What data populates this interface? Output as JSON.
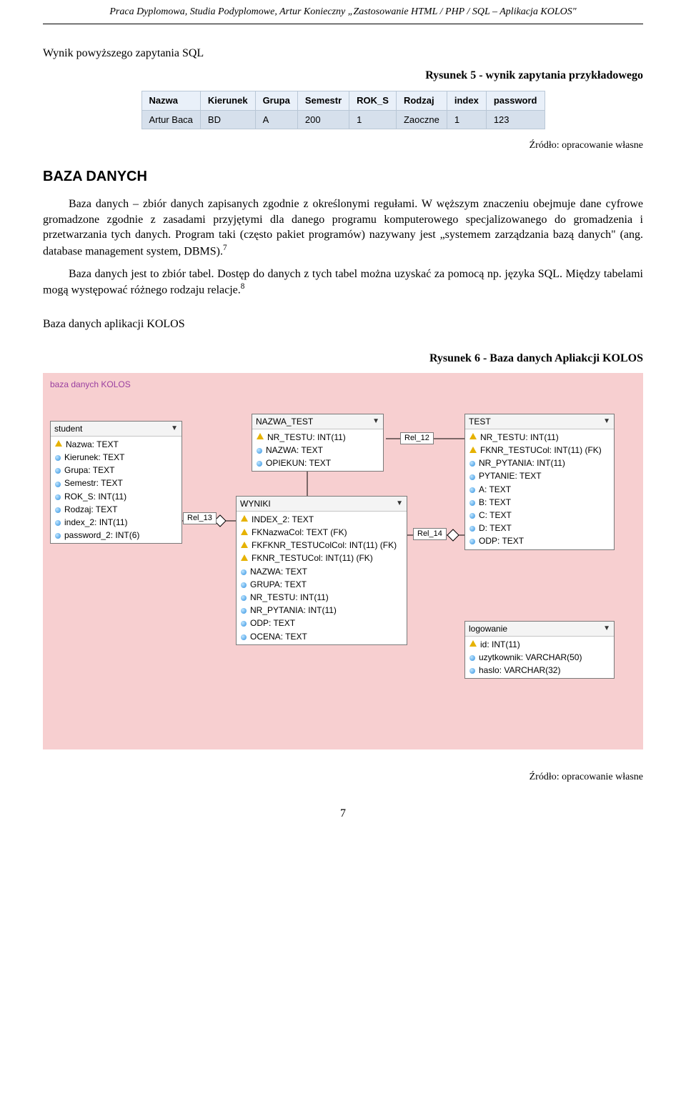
{
  "header": "Praca Dyplomowa, Studia Podyplomowe, Artur Konieczny „Zastosowanie HTML / PHP / SQL – Aplikacja KOLOS\"",
  "para_title": "Wynik powyższego zapytania SQL",
  "figure5_caption": "Rysunek 5 - wynik zapytania przykładowego",
  "source": "Źródło: opracowanie własne",
  "section_title": "BAZA DANYCH",
  "body": {
    "p1a": "Baza danych – zbiór danych zapisanych zgodnie z określonymi regułami. W węższym znaczeniu obejmuje dane cyfrowe gromadzone zgodnie z zasadami przyjętymi dla danego programu komputerowego specjalizowanego do gromadzenia i przetwarzania tych danych. Program taki (często pakiet programów) nazywany jest „systemem zarządzania bazą danych\" (ang. database management system, DBMS).",
    "p1_sup": "7",
    "p2a": "Baza danych jest to zbiór tabel. Dostęp do danych z tych tabel można uzyskać za pomocą np. języka SQL. Między tabelami mogą występować różnego rodzaju relacje.",
    "p2_sup": "8",
    "sub_heading": "Baza danych aplikacji  KOLOS"
  },
  "figure6_caption": "Rysunek 6 - Baza danych Apliakcji KOLOS",
  "page_number": "7",
  "sql_table": {
    "headers": [
      "Nazwa",
      "Kierunek",
      "Grupa",
      "Semestr",
      "ROK_S",
      "Rodzaj",
      "index",
      "password"
    ],
    "rows": [
      [
        "Artur Baca",
        "BD",
        "A",
        "200",
        "1",
        "Zaoczne",
        "1",
        "123"
      ]
    ]
  },
  "schema": {
    "panel_title": "baza danych KOLOS",
    "tables": {
      "student": {
        "name": "student",
        "cols": [
          {
            "k": true,
            "t": "Nazwa: TEXT"
          },
          {
            "k": false,
            "t": "Kierunek: TEXT"
          },
          {
            "k": false,
            "t": "Grupa: TEXT"
          },
          {
            "k": false,
            "t": "Semestr: TEXT"
          },
          {
            "k": false,
            "t": "ROK_S: INT(11)"
          },
          {
            "k": false,
            "t": "Rodzaj: TEXT"
          },
          {
            "k": false,
            "t": "index_2: INT(11)"
          },
          {
            "k": false,
            "t": "password_2: INT(6)"
          }
        ]
      },
      "nazwa_test": {
        "name": "NAZWA_TEST",
        "cols": [
          {
            "k": true,
            "t": "NR_TESTU: INT(11)"
          },
          {
            "k": false,
            "t": "NAZWA: TEXT"
          },
          {
            "k": false,
            "t": "OPIEKUN: TEXT"
          }
        ]
      },
      "wyniki": {
        "name": "WYNIKI",
        "cols": [
          {
            "k": true,
            "t": "INDEX_2: TEXT"
          },
          {
            "k": true,
            "t": "FKNazwaCol: TEXT (FK)"
          },
          {
            "k": true,
            "t": "FKFKNR_TESTUColCol: INT(11) (FK)"
          },
          {
            "k": true,
            "t": "FKNR_TESTUCol: INT(11) (FK)"
          },
          {
            "k": false,
            "t": "NAZWA: TEXT"
          },
          {
            "k": false,
            "t": "GRUPA: TEXT"
          },
          {
            "k": false,
            "t": "NR_TESTU: INT(11)"
          },
          {
            "k": false,
            "t": "NR_PYTANIA: INT(11)"
          },
          {
            "k": false,
            "t": "ODP: TEXT"
          },
          {
            "k": false,
            "t": "OCENA: TEXT"
          }
        ]
      },
      "test": {
        "name": "TEST",
        "cols": [
          {
            "k": true,
            "t": "NR_TESTU: INT(11)"
          },
          {
            "k": true,
            "t": "FKNR_TESTUCol: INT(11) (FK)"
          },
          {
            "k": false,
            "t": "NR_PYTANIA: INT(11)"
          },
          {
            "k": false,
            "t": "PYTANIE: TEXT"
          },
          {
            "k": false,
            "t": "A: TEXT"
          },
          {
            "k": false,
            "t": "B: TEXT"
          },
          {
            "k": false,
            "t": "C: TEXT"
          },
          {
            "k": false,
            "t": "D: TEXT"
          },
          {
            "k": false,
            "t": "ODP: TEXT"
          }
        ]
      },
      "logowanie": {
        "name": "logowanie",
        "cols": [
          {
            "k": true,
            "t": "id: INT(11)"
          },
          {
            "k": false,
            "t": "uzytkownik: VARCHAR(50)"
          },
          {
            "k": false,
            "t": "haslo: VARCHAR(32)"
          }
        ]
      }
    },
    "rels": {
      "r12": "Rel_12",
      "r13": "Rel_13",
      "r14": "Rel_14"
    }
  }
}
